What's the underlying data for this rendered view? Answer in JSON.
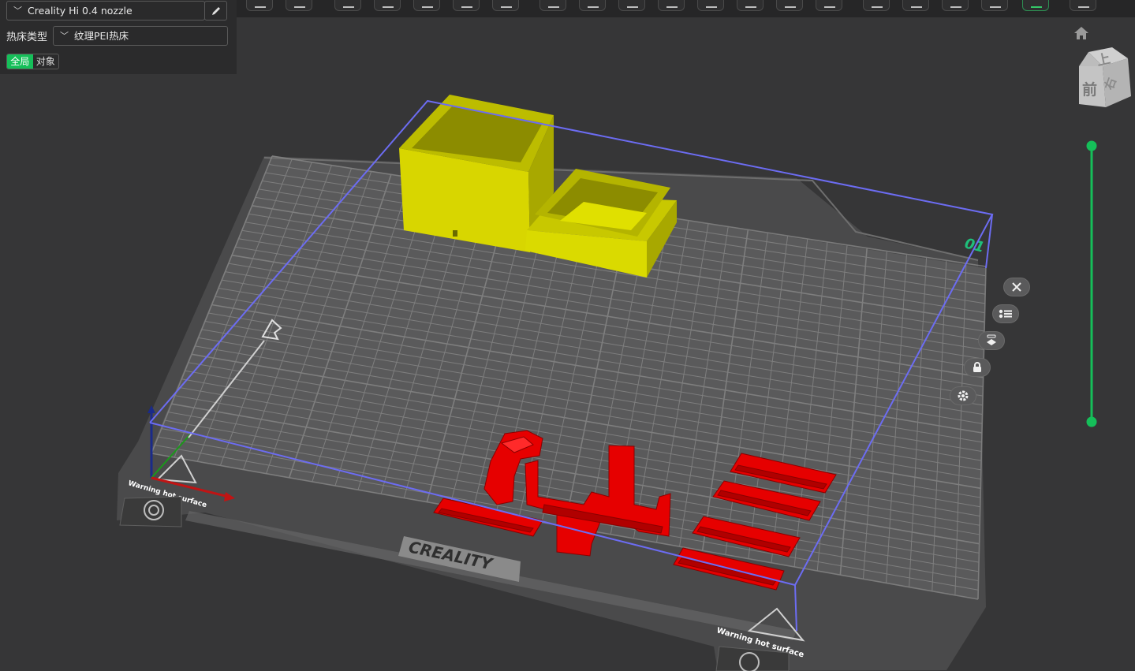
{
  "printer": {
    "name": "Creality Hi 0.4 nozzle"
  },
  "bed_type": {
    "label": "热床类型",
    "value": "纹理PEI热床"
  },
  "scope_toggle": {
    "global_label": "全局",
    "object_label": "对象",
    "active": "global"
  },
  "view_cube": {
    "top_label": "上",
    "front_label": "前",
    "right_label": "右"
  },
  "plate": {
    "brand_label": "CREALITY",
    "warning_left": "Warning hot surface",
    "warning_right": "Warning hot surface",
    "plate_number": "01"
  },
  "colors": {
    "accent": "#15bf59",
    "bounding_box": "#6c6cf2",
    "model_yellow": "#d8d600",
    "model_red": "#e60000",
    "plate_number": "#1fbf7a"
  },
  "icons": {
    "edit": "pencil-icon",
    "home": "home-icon",
    "side_buttons": [
      "close-icon",
      "list-icon",
      "auto-orient-icon",
      "lock-icon",
      "gear-icon"
    ]
  }
}
